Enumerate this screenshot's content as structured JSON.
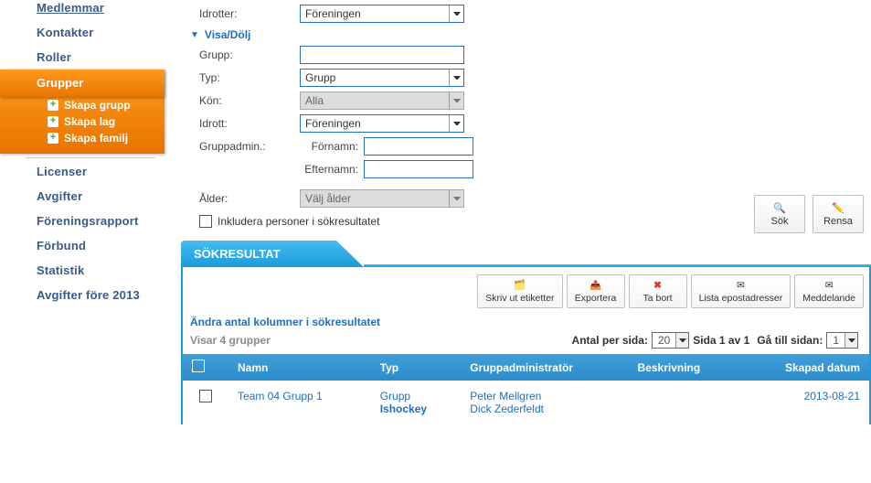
{
  "sidebar": {
    "items_top": [
      "Medlemmar",
      "Kontakter",
      "Roller"
    ],
    "active": "Grupper",
    "subs": [
      "Skapa grupp",
      "Skapa lag",
      "Skapa familj"
    ],
    "items_bottom": [
      "Licenser",
      "Avgifter",
      "Föreningsrapport",
      "Förbund",
      "Statistik",
      "Avgifter före 2013"
    ]
  },
  "form": {
    "idrotter_label": "Idrotter:",
    "idrotter_value": "Föreningen",
    "visa_header": "Visa/Dölj",
    "grupp_label": "Grupp:",
    "typ_label": "Typ:",
    "typ_value": "Grupp",
    "kon_label": "Kön:",
    "kon_value": "Alla",
    "idrott_label": "Idrott:",
    "idrott_value": "Föreningen",
    "gruppadmin_label": "Gruppadmin.:",
    "fornamn_label": "Förnamn:",
    "efternamn_label": "Efternamn:",
    "alder_label": "Ålder:",
    "alder_value": "Välj ålder",
    "inkludera_label": "Inkludera personer i sökresultatet",
    "sok_btn": "Sök",
    "rensa_btn": "Rensa"
  },
  "results": {
    "header": "SÖKRESULTAT",
    "toolbar": {
      "skriv": "Skriv ut etiketter",
      "exportera": "Exportera",
      "tabort": "Ta bort",
      "lista": "Lista epostadresser",
      "meddelande": "Meddelande"
    },
    "columns_link": "Ändra antal kolumner i sökresultatet",
    "showing": "Visar 4 grupper",
    "per_page_label": "Antal per sida:",
    "per_page_value": "20",
    "page_info": "Sida 1 av 1",
    "goto_label": "Gå till sidan:",
    "goto_value": "1",
    "headers": {
      "namn": "Namn",
      "typ": "Typ",
      "admin": "Gruppadministratör",
      "beskr": "Beskrivning",
      "datum": "Skapad datum"
    },
    "rows": [
      {
        "namn": "Team 04 Grupp 1",
        "typ_line1": "Grupp",
        "typ_line2": "Ishockey",
        "admins": [
          "Peter Mellgren",
          "Dick Zederfeldt"
        ],
        "beskr": "",
        "datum": "2013-08-21"
      }
    ]
  }
}
